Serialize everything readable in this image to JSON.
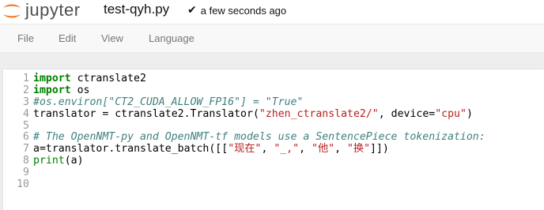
{
  "header": {
    "logo_text": "jupyter",
    "filename": "test-qyh.py",
    "save_status": "a few seconds ago",
    "check_icon": "check-icon"
  },
  "menu": {
    "items": [
      "File",
      "Edit",
      "View",
      "Language"
    ]
  },
  "editor": {
    "lines": [
      {
        "n": "1",
        "text": "import ctranslate2"
      },
      {
        "n": "2",
        "text": "import os"
      },
      {
        "n": "3",
        "text": "#os.environ[\"CT2_CUDA_ALLOW_FP16\"] = \"True\""
      },
      {
        "n": "4",
        "text": "translator = ctranslate2.Translator(\"zhen_ctranslate2/\", device=\"cpu\")"
      },
      {
        "n": "5",
        "text": ""
      },
      {
        "n": "6",
        "text": "# The OpenNMT-py and OpenNMT-tf models use a SentencePiece tokenization:"
      },
      {
        "n": "7",
        "text": "a=translator.translate_batch([[\"现在\", \"_,\", \"他\", \"换\"]])"
      },
      {
        "n": "8",
        "text": "print(a)"
      },
      {
        "n": "9",
        "text": ""
      },
      {
        "n": "10",
        "text": ""
      }
    ]
  },
  "colors": {
    "keyword": "#008000",
    "string": "#ba2121",
    "comment": "#408080",
    "logo_orange": "#f37726"
  }
}
